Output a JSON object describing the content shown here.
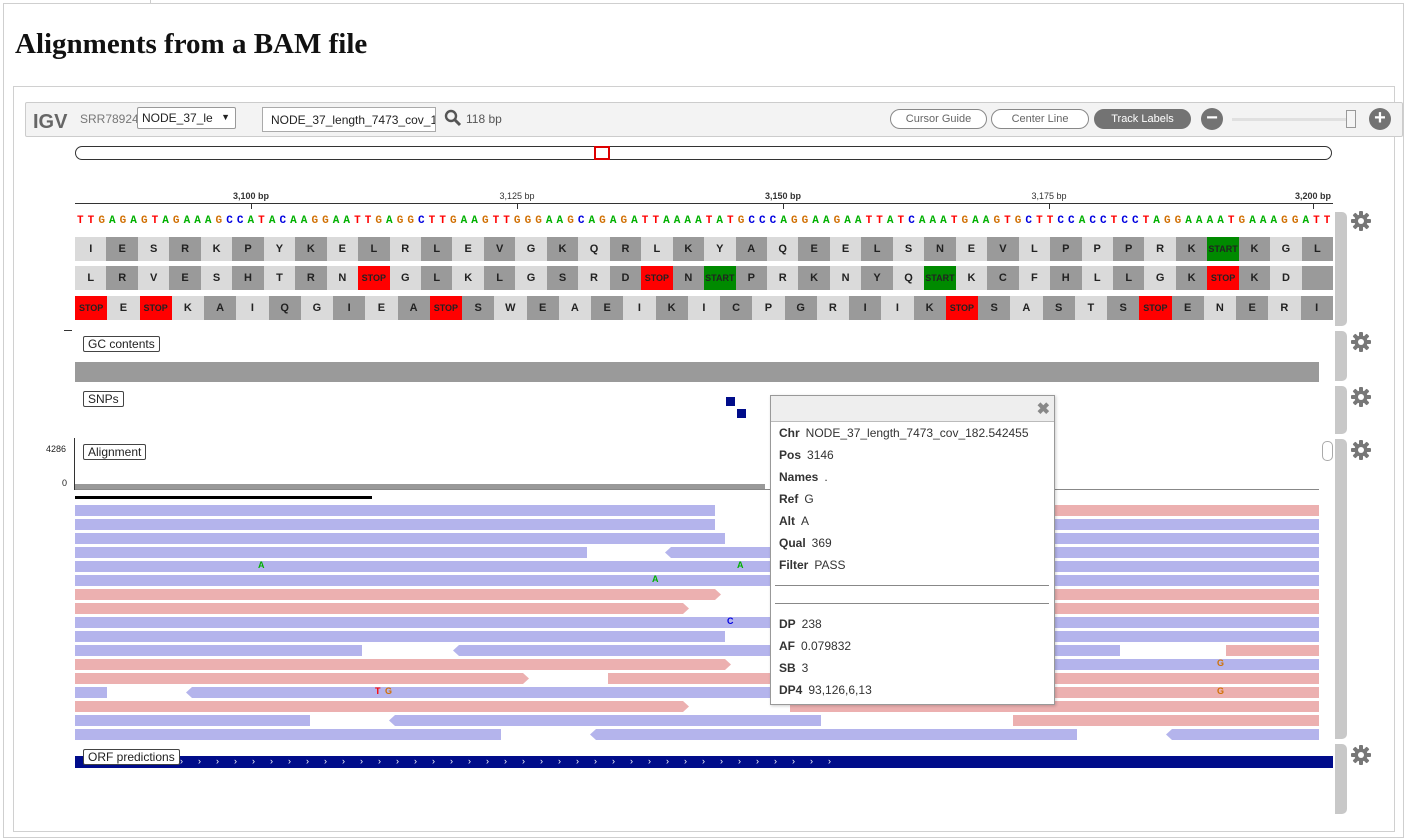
{
  "page": {
    "title": "Alignments from a BAM file"
  },
  "navbar": {
    "logo": "IGV",
    "genome": "SRR78924",
    "chrom_select": "NODE_37_le",
    "locus": "NODE_37_length_7473_cov_1",
    "bp_width": "118 bp",
    "buttons": {
      "cursor_guide": "Cursor Guide",
      "center_line": "Center Line",
      "track_labels": "Track Labels"
    },
    "zoom_out": "−",
    "zoom_in": "+"
  },
  "ruler": {
    "ticks": [
      "3,100 bp",
      "3,125 bp",
      "3,150 bp",
      "3,175 bp",
      "3,200 bp"
    ]
  },
  "sequence": "TTGAGAGTAGAAAGCCATACAAGGAATTGAGGCTTGAAGTTGGGAAGCAGAGATTAAAATATGCCCAGGAAGAATTATCAAATGAAGTGCTTCCACCTCCTAGGAAAATGAAAGGATT",
  "base_colors": {
    "A": "#00b000",
    "C": "#0000e0",
    "G": "#d17105",
    "T": "#ff0000"
  },
  "translation": {
    "frame1": [
      "I",
      "E",
      "S",
      "R",
      "K",
      "P",
      "Y",
      "K",
      "E",
      "L",
      "R",
      "L",
      "E",
      "V",
      "G",
      "K",
      "Q",
      "R",
      "L",
      "K",
      "Y",
      "A",
      "Q",
      "E",
      "E",
      "L",
      "S",
      "N",
      "E",
      "V",
      "L",
      "P",
      "P",
      "P",
      "R",
      "K",
      "START",
      "K",
      "G",
      "L"
    ],
    "frame2": [
      "L",
      "R",
      "V",
      "E",
      "S",
      "H",
      "T",
      "R",
      "N",
      "STOP",
      "G",
      "L",
      "K",
      "L",
      "G",
      "S",
      "R",
      "D",
      "STOP",
      "N",
      "START",
      "P",
      "R",
      "K",
      "N",
      "Y",
      "Q",
      "START",
      "K",
      "C",
      "F",
      "H",
      "L",
      "L",
      "G",
      "K",
      "STOP",
      "K",
      "D",
      ""
    ],
    "frame3": [
      "STOP",
      "E",
      "STOP",
      "K",
      "A",
      "I",
      "Q",
      "G",
      "I",
      "E",
      "A",
      "STOP",
      "S",
      "W",
      "E",
      "A",
      "E",
      "I",
      "K",
      "I",
      "C",
      "P",
      "G",
      "R",
      "I",
      "I",
      "K",
      "STOP",
      "S",
      "A",
      "S",
      "T",
      "S",
      "STOP",
      "E",
      "N",
      "E",
      "R",
      "I"
    ]
  },
  "tracks": {
    "gc": "GC contents",
    "snps": "SNPs",
    "alignment": "Alignment",
    "orf": "ORF predictions"
  },
  "coverage": {
    "max": "4286",
    "min": "0"
  },
  "mismatches": [
    {
      "base": "A"
    },
    {
      "base": "A"
    },
    {
      "base": "A"
    },
    {
      "base": "C"
    },
    {
      "base": "T"
    },
    {
      "base": "G"
    },
    {
      "base": "G"
    },
    {
      "base": "G"
    }
  ],
  "popup": {
    "close": "✖",
    "chr_label": "Chr",
    "chr": "NODE_37_length_7473_cov_182.542455",
    "pos_label": "Pos",
    "pos": "3146",
    "names_label": "Names",
    "names": ".",
    "ref_label": "Ref",
    "ref": "G",
    "alt_label": "Alt",
    "alt": "A",
    "qual_label": "Qual",
    "qual": "369",
    "filter_label": "Filter",
    "filter": "PASS",
    "dp_label": "DP",
    "dp": "238",
    "af_label": "AF",
    "af": "0.079832",
    "sb_label": "SB",
    "sb": "3",
    "dp4_label": "DP4",
    "dp4": "93,126,6,13"
  },
  "colors": {
    "forward_read": "#b4b4ec",
    "reverse_read": "#ecb0b0",
    "orf": "#000c8a",
    "snp": "#000c8a"
  }
}
